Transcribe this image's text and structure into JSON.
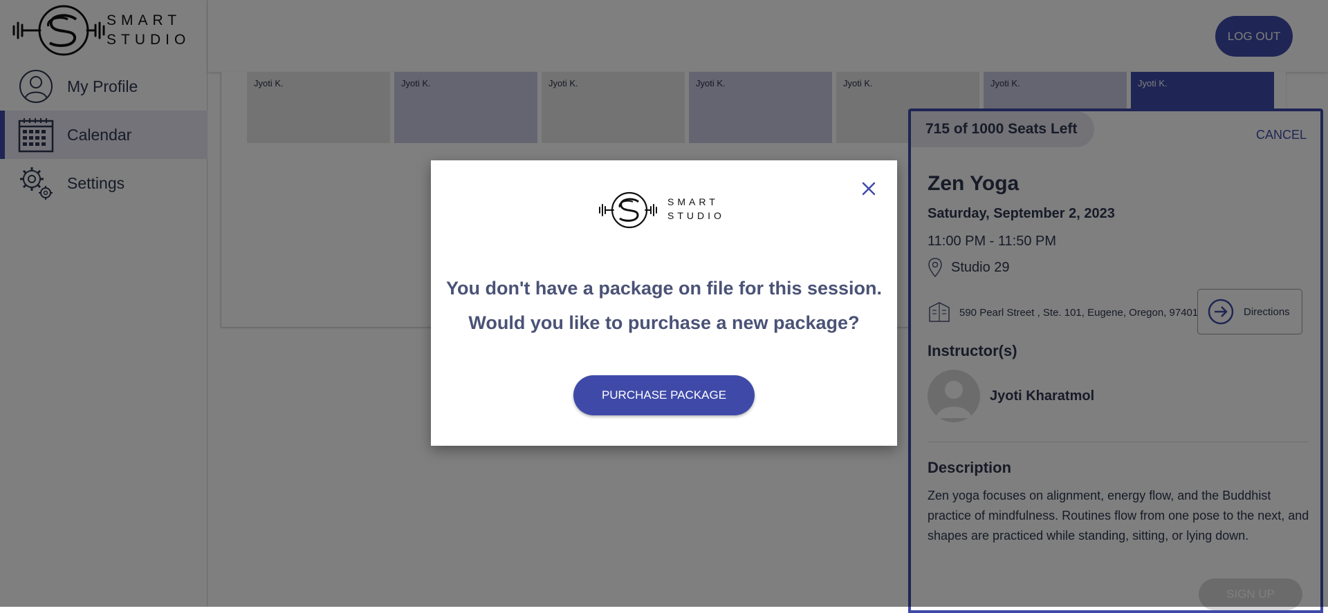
{
  "app": {
    "brand_top": "SMART",
    "brand_bottom": "STUDIO",
    "accent_color": "#3f4aa8"
  },
  "sidebar": {
    "items": [
      {
        "label": "My Profile",
        "icon": "profile-icon"
      },
      {
        "label": "Calendar",
        "icon": "calendar-icon",
        "active": true
      },
      {
        "label": "Settings",
        "icon": "gear-icon"
      }
    ]
  },
  "header": {
    "logout_label": "LOG OUT"
  },
  "calendar": {
    "cells": [
      {
        "text": "Jyoti K.",
        "shade": "#e6e6e6"
      },
      {
        "text": "Jyoti K.",
        "shade": "#c9cbe0"
      },
      {
        "text": "Jyoti K.",
        "shade": "#e6e6e6"
      },
      {
        "text": "Jyoti K.",
        "shade": "#c9cbe0"
      },
      {
        "text": "Jyoti K.",
        "shade": "#e6e6e6"
      },
      {
        "text": "Jyoti K.",
        "shade": "#c9cbe0"
      },
      {
        "text": "Jyoti K.",
        "shade": "#3f4aa8"
      }
    ]
  },
  "detail": {
    "seats": "715 of 1000 Seats Left",
    "cancel_label": "CANCEL",
    "title": "Zen Yoga",
    "date": "Saturday, September 2, 2023",
    "time": "11:00 PM - 11:50 PM",
    "room": "Studio 29",
    "address": "590 Pearl Street , Ste. 101, Eugene, Oregon, 97401",
    "directions_label": "Directions",
    "instructors_heading": "Instructor(s)",
    "instructor_name": "Jyoti Kharatmol",
    "description_heading": "Description",
    "description": "Zen yoga focuses on alignment, energy flow, and the Buddhist practice of mindfulness. Routines flow from one pose to the next, and shapes are practiced while standing, sitting, or lying down.",
    "signup_label": "SIGN UP"
  },
  "modal": {
    "logo_top": "SMART",
    "logo_bottom": "STUDIO",
    "line1": "You don't have a package on file for this session.",
    "line2": "Would you like to purchase a new package?",
    "purchase_label": "PURCHASE PACKAGE"
  }
}
